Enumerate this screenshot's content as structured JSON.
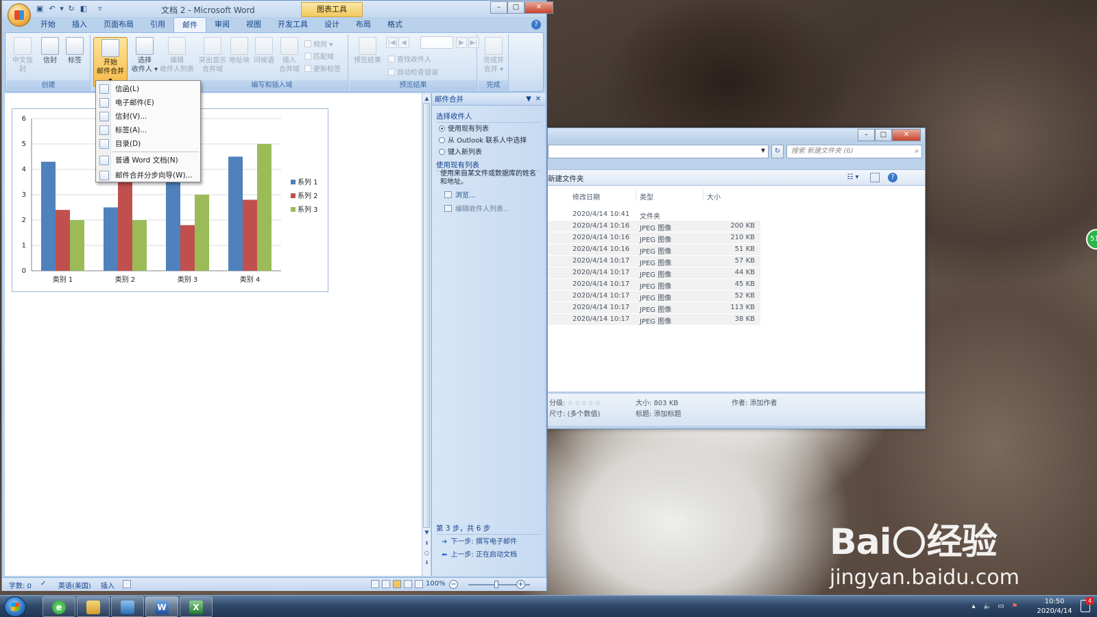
{
  "colors": {
    "series1": "#4f81bd",
    "series2": "#c0504d",
    "series3": "#9bbb59",
    "ribbon_active": "#f6b94a"
  },
  "word": {
    "title": "文档 2 - Microsoft Word",
    "chart_tools": "图表工具",
    "tabs": [
      "开始",
      "插入",
      "页面布局",
      "引用",
      "邮件",
      "审阅",
      "视图",
      "开发工具",
      "设计",
      "布局",
      "格式"
    ],
    "active_tab": "邮件",
    "groups": {
      "create": "创建",
      "write_insert": "编写和插入域",
      "preview": "预览结果",
      "finish": "完成"
    },
    "buttons": {
      "chinese_envelope": "中文信封",
      "envelope": "信封",
      "labels": "标签",
      "start_merge_1": "开始",
      "start_merge_2": "邮件合并",
      "select_recipients_1": "选择",
      "select_recipients_2": "收件人",
      "edit_list_1": "编辑",
      "edit_list_2": "收件人列表",
      "highlight_1": "突出显示",
      "highlight_2": "合并域",
      "address_block": "地址块",
      "greeting": "问候语",
      "insert_field_1": "插入",
      "insert_field_2": "合并域",
      "rules": "规则",
      "match_fields": "匹配域",
      "update_labels": "更新标签",
      "preview_results": "预览结果",
      "find_recipient": "查找收件人",
      "auto_check": "自动检查错误",
      "finish_1": "完成并",
      "finish_2": "合并"
    },
    "menu": [
      "信函(L)",
      "电子邮件(E)",
      "信封(V)...",
      "标签(A)...",
      "目录(D)",
      "普通 Word 文档(N)",
      "邮件合并分步向导(W)..."
    ],
    "taskpane": {
      "title": "邮件合并",
      "select_recipients": "选择收件人",
      "opt_existing": "使用现有列表",
      "opt_outlook": "从 Outlook 联系人中选择",
      "opt_new": "键入新列表",
      "use_existing": "使用现有列表",
      "desc": "使用来自某文件或数据库的姓名和地址。",
      "browse": "浏览...",
      "edit_list": "编辑收件人列表...",
      "step": "第 3 步，共 6 步",
      "next": "下一步: 撰写电子邮件",
      "prev": "上一步: 正在启动文档"
    },
    "status": {
      "word_count": "字数: 0",
      "language": "英语(美国)",
      "mode": "插入",
      "zoom": "100%"
    }
  },
  "chart_data": {
    "type": "bar",
    "categories": [
      "类别 1",
      "类别 2",
      "类别 3",
      "类别 4"
    ],
    "series": [
      {
        "name": "系列 1",
        "values": [
          4.3,
          2.5,
          3.5,
          4.5
        ]
      },
      {
        "name": "系列 2",
        "values": [
          2.4,
          4.4,
          1.8,
          2.8
        ]
      },
      {
        "name": "系列 3",
        "values": [
          2.0,
          2.0,
          3.0,
          5.0
        ]
      }
    ],
    "yticks": [
      "0",
      "1",
      "2",
      "3",
      "4",
      "5",
      "6"
    ],
    "ylim": [
      0,
      6
    ],
    "legend": "right"
  },
  "explorer": {
    "search_placeholder": "搜索 新建文件夹 (6)",
    "folder_name": "新建文件夹",
    "columns": [
      "修改日期",
      "类型",
      "大小"
    ],
    "rows": [
      {
        "date": "2020/4/14 10:41",
        "type": "文件夹",
        "size": ""
      },
      {
        "date": "2020/4/14 10:16",
        "type": "JPEG 图像",
        "size": "200 KB"
      },
      {
        "date": "2020/4/14 10:16",
        "type": "JPEG 图像",
        "size": "210 KB"
      },
      {
        "date": "2020/4/14 10:16",
        "type": "JPEG 图像",
        "size": "51 KB"
      },
      {
        "date": "2020/4/14 10:17",
        "type": "JPEG 图像",
        "size": "57 KB"
      },
      {
        "date": "2020/4/14 10:17",
        "type": "JPEG 图像",
        "size": "44 KB"
      },
      {
        "date": "2020/4/14 10:17",
        "type": "JPEG 图像",
        "size": "45 KB"
      },
      {
        "date": "2020/4/14 10:17",
        "type": "JPEG 图像",
        "size": "52 KB"
      },
      {
        "date": "2020/4/14 10:17",
        "type": "JPEG 图像",
        "size": "113 KB"
      },
      {
        "date": "2020/4/14 10:17",
        "type": "JPEG 图像",
        "size": "38 KB"
      }
    ],
    "details": {
      "rating_label": "分级:",
      "stars": "☆☆☆☆☆",
      "dims": "尺寸: (多个数值)",
      "size": "大小: 803 KB",
      "title": "标题: 添加标题",
      "author": "作者: 添加作者"
    }
  },
  "desktop": {
    "watermark_brand_1": "Bai",
    "watermark_brand_2": "经验",
    "watermark_url": "jingyan.baidu.com",
    "side_badge": "51"
  },
  "taskbar": {
    "time": "10:50",
    "date": "2020/4/14",
    "notif": "4"
  }
}
